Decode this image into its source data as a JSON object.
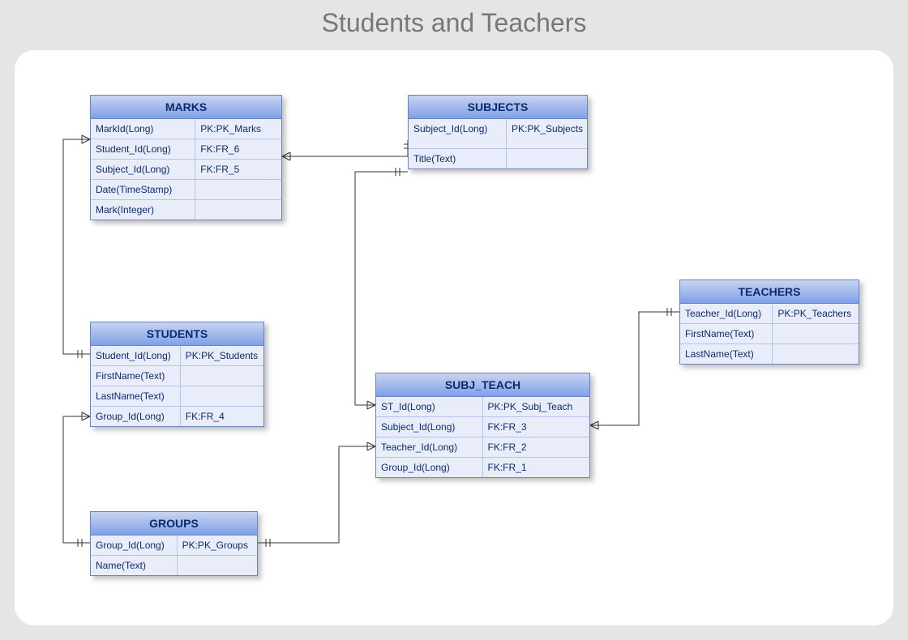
{
  "title": "Students and Teachers",
  "entities": {
    "marks": {
      "name": "MARKS",
      "rows": [
        {
          "col1": "MarkId(Long)",
          "col2": "PK:PK_Marks"
        },
        {
          "col1": "Student_Id(Long)",
          "col2": "FK:FR_6"
        },
        {
          "col1": "Subject_Id(Long)",
          "col2": "FK:FR_5"
        },
        {
          "col1": "Date(TimeStamp)",
          "col2": ""
        },
        {
          "col1": "Mark(Integer)",
          "col2": ""
        }
      ]
    },
    "subjects": {
      "name": "SUBJECTS",
      "rows": [
        {
          "col1": "Subject_Id(Long)",
          "col2": "PK:PK_Subjects"
        },
        {
          "col1": "Title(Text)",
          "col2": ""
        }
      ]
    },
    "students": {
      "name": "STUDENTS",
      "rows": [
        {
          "col1": "Student_Id(Long)",
          "col2": "PK:PK_Students"
        },
        {
          "col1": "FirstName(Text)",
          "col2": ""
        },
        {
          "col1": "LastName(Text)",
          "col2": ""
        },
        {
          "col1": "Group_Id(Long)",
          "col2": "FK:FR_4"
        }
      ]
    },
    "teachers": {
      "name": "TEACHERS",
      "rows": [
        {
          "col1": "Teacher_Id(Long)",
          "col2": "PK:PK_Teachers"
        },
        {
          "col1": "FirstName(Text)",
          "col2": ""
        },
        {
          "col1": "LastName(Text)",
          "col2": ""
        }
      ]
    },
    "subj_teach": {
      "name": "SUBJ_TEACH",
      "rows": [
        {
          "col1": "ST_Id(Long)",
          "col2": "PK:PK_Subj_Teach"
        },
        {
          "col1": "Subject_Id(Long)",
          "col2": "FK:FR_3"
        },
        {
          "col1": "Teacher_Id(Long)",
          "col2": "FK:FR_2"
        },
        {
          "col1": "Group_Id(Long)",
          "col2": "FK:FR_1"
        }
      ]
    },
    "groups": {
      "name": "GROUPS",
      "rows": [
        {
          "col1": "Group_Id(Long)",
          "col2": "PK:PK_Groups"
        },
        {
          "col1": "Name(Text)",
          "col2": ""
        }
      ]
    }
  }
}
